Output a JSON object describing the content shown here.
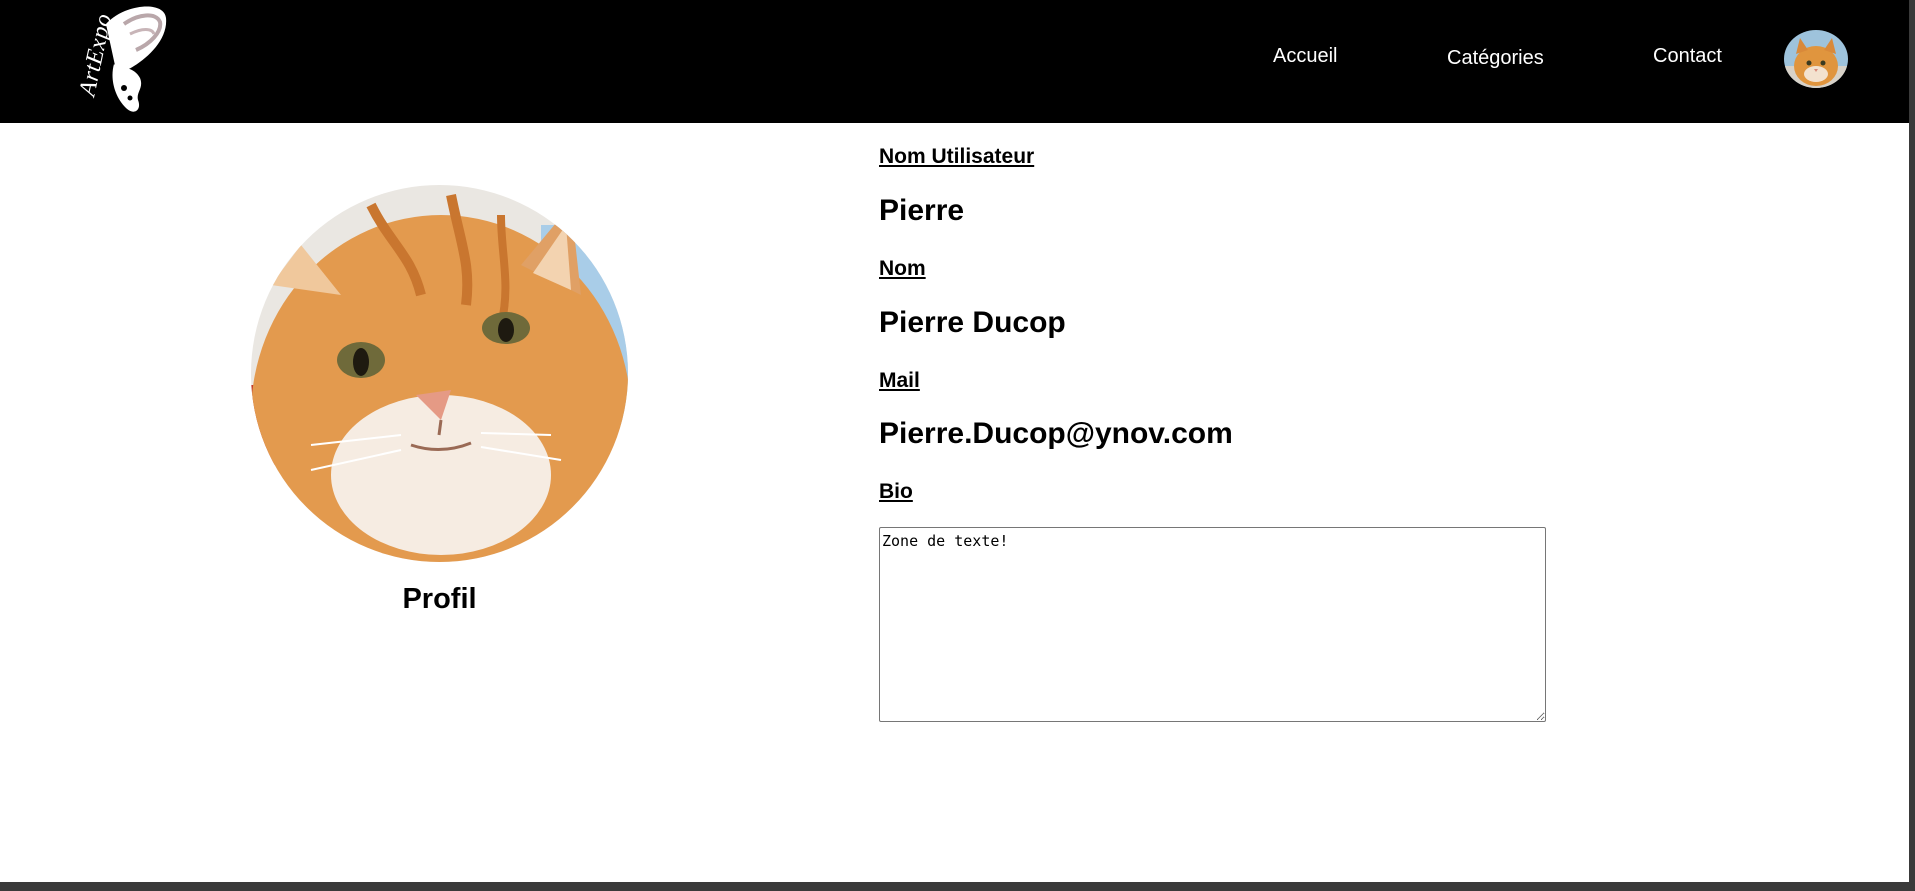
{
  "nav": {
    "logo_text": "ArtExpo",
    "links": [
      "Accueil",
      "Catégories",
      "Contact"
    ]
  },
  "profile": {
    "title": "Profil"
  },
  "fields": {
    "username_label": "Nom Utilisateur",
    "username_value": "Pierre",
    "name_label": "Nom",
    "name_value": "Pierre Ducop",
    "mail_label": "Mail",
    "mail_value": "Pierre.Ducop@ynov.com",
    "bio_label": "Bio",
    "bio_value": "Zone de texte!"
  }
}
